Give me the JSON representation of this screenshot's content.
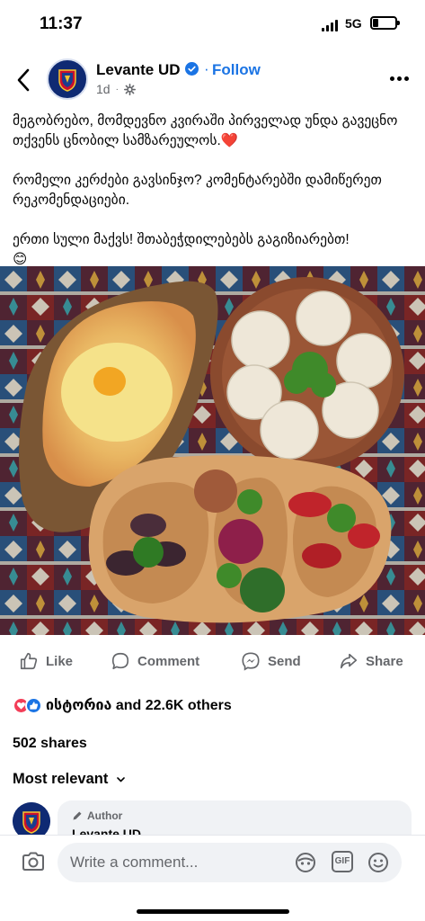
{
  "status_bar": {
    "time": "11:37",
    "network": "5G"
  },
  "post": {
    "page_name": "Levante UD",
    "follow_label": "Follow",
    "separator": "·",
    "age": "1d",
    "paragraphs": [
      "მეგობრებო, მომდევნო კვირაში პირველად უნდა გავეცნო თქვენს ცნობილ სამზარეულოს.",
      "რომელი კერძები გავსინჯო? კომენტარებში დამიწერეთ რეკომენდაციები.",
      "ერთი სული მაქვს! შთაბეჭდილებებს გაგიზიარებთ!"
    ],
    "emoji_heart": "❤️",
    "emoji_smile": "😊"
  },
  "actions": {
    "like": "Like",
    "comment": "Comment",
    "send": "Send",
    "share": "Share"
  },
  "reactions": {
    "text": "ისტორია and 22.6K others"
  },
  "shares": "502 shares",
  "sort_label": "Most relevant",
  "comment": {
    "badge": "Author",
    "name": "Levante UD"
  },
  "composer": {
    "placeholder": "Write a comment..."
  },
  "colors": {
    "accent": "#1b74e4",
    "secondary_text": "#65676b",
    "bubble": "#f0f2f5"
  }
}
